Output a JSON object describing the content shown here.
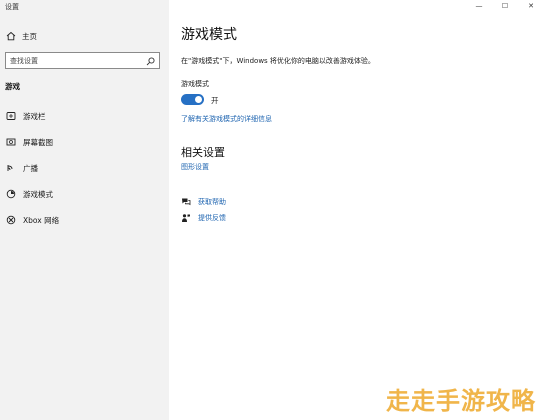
{
  "window": {
    "title": "设置",
    "controls": {
      "minimize": "—",
      "maximize": "☐",
      "close": "✕"
    }
  },
  "sidebar": {
    "home_label": "主页",
    "search_placeholder": "查找设置",
    "section_title": "游戏",
    "items": [
      {
        "label": "游戏栏",
        "icon": "game-bar-icon"
      },
      {
        "label": "屏幕截图",
        "icon": "screenshot-icon"
      },
      {
        "label": "广播",
        "icon": "broadcast-icon"
      },
      {
        "label": "游戏模式",
        "icon": "game-mode-icon"
      },
      {
        "label": "Xbox 网络",
        "icon": "xbox-icon"
      }
    ]
  },
  "main": {
    "title": "游戏模式",
    "description": "在\"游戏模式\"下，Windows 将优化你的电脑以改善游戏体验。",
    "toggle_label": "游戏模式",
    "toggle_state": "开",
    "toggle_on": true,
    "learn_more_link": "了解有关游戏模式的详细信息",
    "related_title": "相关设置",
    "graphics_link": "图形设置",
    "help_label": "获取帮助",
    "feedback_label": "提供反馈"
  },
  "watermark": "走走手游攻略",
  "colors": {
    "accent": "#2670c4",
    "link": "#1e64b0",
    "sidebar_bg": "#f2f2f2",
    "watermark": "#f0b54a"
  }
}
